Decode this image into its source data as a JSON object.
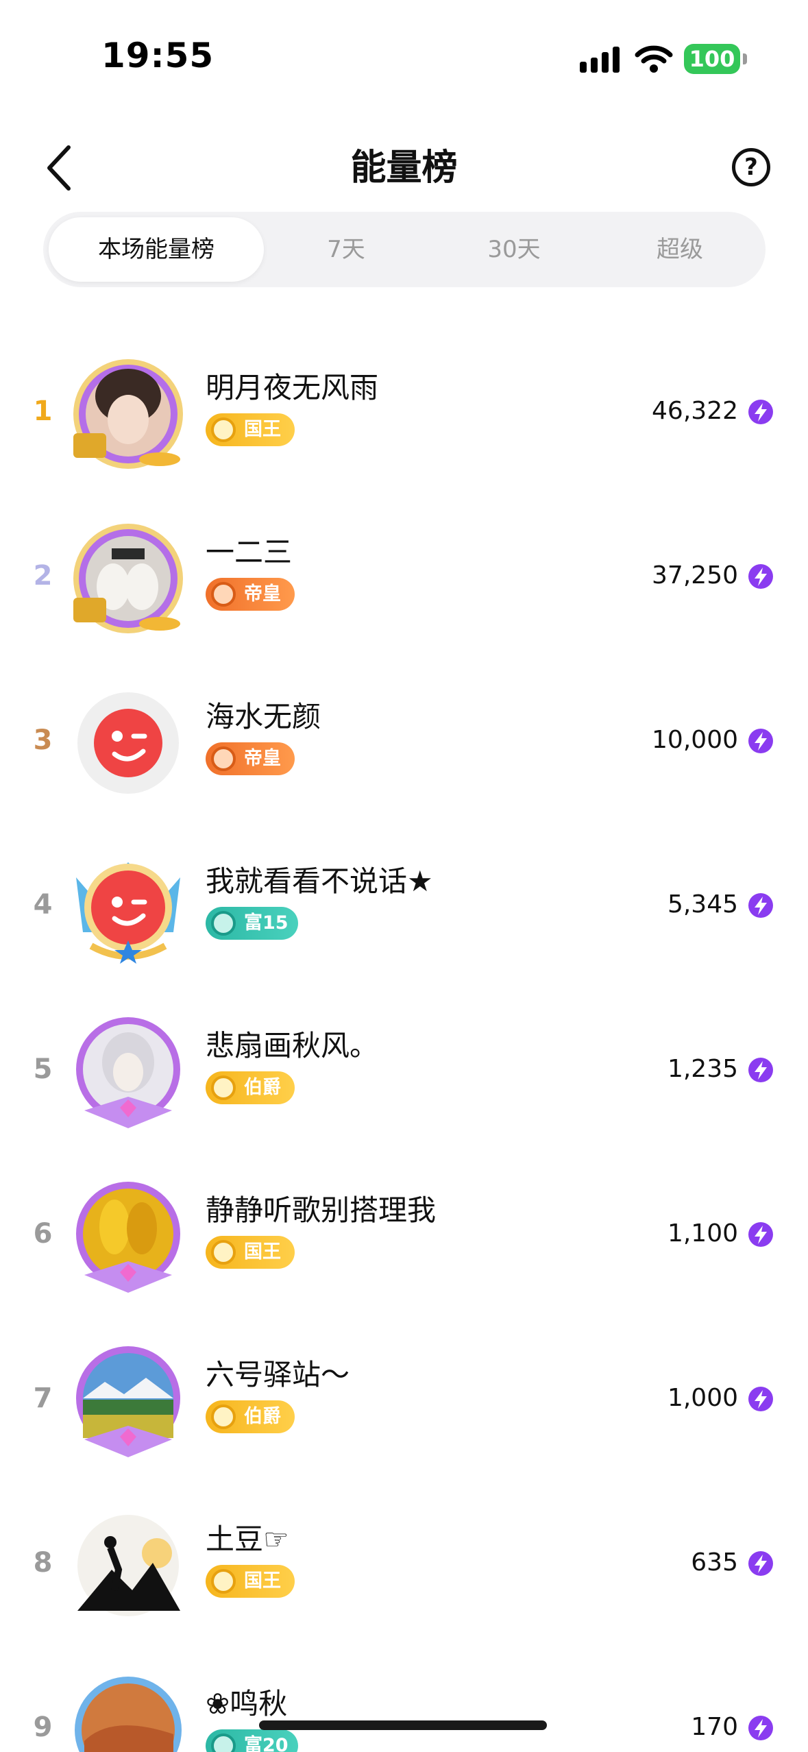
{
  "status": {
    "time": "19:55",
    "battery": "100"
  },
  "header": {
    "title": "能量榜",
    "help_glyph": "?"
  },
  "tabs": [
    {
      "label": "本场能量榜",
      "active": true
    },
    {
      "label": "7天",
      "active": false
    },
    {
      "label": "30天",
      "active": false
    },
    {
      "label": "超级",
      "active": false
    }
  ],
  "ranking": [
    {
      "rank": "1",
      "name": "明月夜无风雨",
      "badge": "国王",
      "badge_style": "gold",
      "score": "46,322"
    },
    {
      "rank": "2",
      "name": "一二三",
      "badge": "帝皇",
      "badge_style": "orange",
      "score": "37,250"
    },
    {
      "rank": "3",
      "name": "海水无颜",
      "badge": "帝皇",
      "badge_style": "orange",
      "score": "10,000"
    },
    {
      "rank": "4",
      "name": "我就看看不说话★",
      "badge": "富15",
      "badge_style": "teal",
      "score": "5,345"
    },
    {
      "rank": "5",
      "name": "悲扇画秋风。",
      "badge": "伯爵",
      "badge_style": "gold",
      "score": "1,235"
    },
    {
      "rank": "6",
      "name": "静静听歌别搭理我",
      "badge": "国王",
      "badge_style": "gold",
      "score": "1,100"
    },
    {
      "rank": "7",
      "name": "六号驿站～",
      "badge": "伯爵",
      "badge_style": "gold",
      "score": "1,000"
    },
    {
      "rank": "8",
      "name": "土豆☞",
      "badge": "国王",
      "badge_style": "gold",
      "score": "635"
    },
    {
      "rank": "9",
      "name": "❀鸣秋",
      "badge": "富20",
      "badge_style": "teal",
      "score": "170"
    }
  ],
  "icons": {
    "back": "chevron-left-icon",
    "help": "question-circle-icon",
    "energy": "lightning-bolt-icon"
  },
  "colors": {
    "rank_gold": "#f0a91b",
    "rank_silver": "#b3b3e6",
    "rank_bronze": "#c98b52",
    "energy_purple": "#8a3cf0",
    "battery_green": "#34c759"
  }
}
